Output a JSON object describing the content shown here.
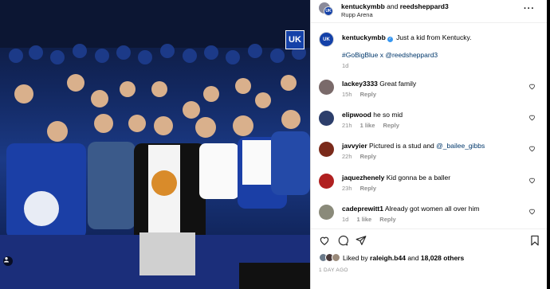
{
  "post": {
    "header": {
      "owner": "kentuckymbb",
      "joiner": "and",
      "collaborator": "reedsheppard3",
      "location": "Rupp Arena",
      "more_icon": "more-horizontal-icon"
    },
    "photo": {
      "logo_text": "UK",
      "user_tags_icon": "user-tag-icon"
    },
    "caption": {
      "username": "kentuckymbb",
      "text": "Just a kid from Kentucky.",
      "hashtags": "#GoBigBlue x @reedsheppard3",
      "time": "1d"
    },
    "comments": [
      {
        "username": "lackey3333",
        "text": "Great family",
        "time": "15h",
        "likes": "",
        "reply": "Reply",
        "avatar_color": "#7a6a6a"
      },
      {
        "username": "elipwood",
        "text": "he so mid",
        "time": "21h",
        "likes": "1 like",
        "reply": "Reply",
        "avatar_color": "#2c3e6b"
      },
      {
        "username": "javvyier",
        "text": "Pictured is a stud and ",
        "mention": "@_bailee_gibbs",
        "time": "22h",
        "likes": "",
        "reply": "Reply",
        "avatar_color": "#7a2a1a"
      },
      {
        "username": "jaquezhenely",
        "text": "Kid gonna be a baller",
        "time": "23h",
        "likes": "",
        "reply": "Reply",
        "avatar_color": "#b02020"
      },
      {
        "username": "cadeprewitt1",
        "text": "Already got women all over him",
        "time": "1d",
        "likes": "1 like",
        "reply": "Reply",
        "avatar_color": "#8a8a7a"
      }
    ],
    "likes": {
      "prefix": "Liked by",
      "user": "raleigh.b44",
      "middle": "and",
      "count": "18,028 others"
    },
    "date": "1 DAY AGO"
  },
  "colors": {
    "link": "#00376b",
    "muted": "#8e8e8e",
    "uk_blue": "#1441a8",
    "verified": "#3897f0"
  }
}
